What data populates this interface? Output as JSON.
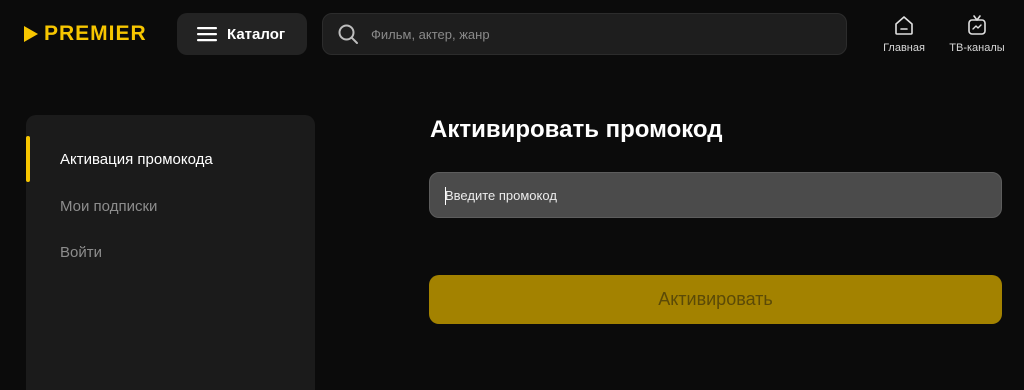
{
  "header": {
    "logo_text": "PREMIER",
    "catalog_label": "Каталог",
    "search_placeholder": "Фильм, актер, жанр",
    "nav": [
      {
        "label": "Главная",
        "icon": "home-icon"
      },
      {
        "label": "ТВ-каналы",
        "icon": "tv-icon"
      }
    ]
  },
  "sidebar": {
    "items": [
      {
        "label": "Активация промокода",
        "active": true
      },
      {
        "label": "Мои подписки",
        "active": false
      },
      {
        "label": "Войти",
        "active": false
      }
    ]
  },
  "main": {
    "title": "Активировать промокод",
    "promo_placeholder": "Введите промокод",
    "promo_value": "",
    "activate_label": "Активировать"
  },
  "colors": {
    "accent": "#f7c600",
    "button_disabled": "#a38200",
    "background": "#0b0b0b",
    "panel": "#1b1b1b"
  }
}
